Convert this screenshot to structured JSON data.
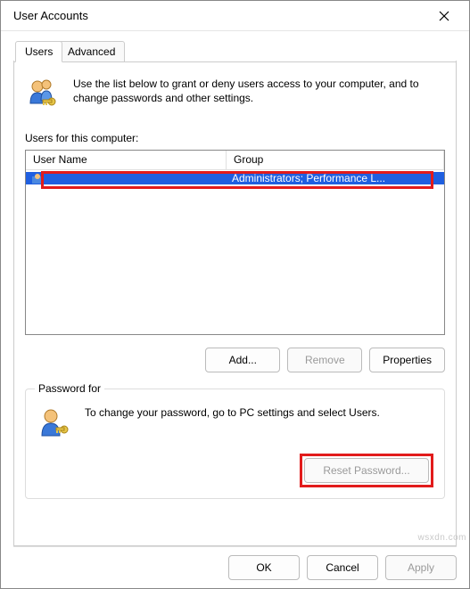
{
  "window": {
    "title": "User Accounts"
  },
  "tabs": {
    "users": "Users",
    "advanced": "Advanced"
  },
  "intro": {
    "text": "Use the list below to grant or deny users access to your computer, and to change passwords and other settings."
  },
  "list": {
    "label": "Users for this computer:",
    "columns": {
      "user": "User Name",
      "group": "Group"
    },
    "rows": [
      {
        "user": "",
        "group": "Administrators; Performance L..."
      }
    ]
  },
  "buttons": {
    "add": "Add...",
    "remove": "Remove",
    "properties": "Properties",
    "reset": "Reset Password...",
    "ok": "OK",
    "cancel": "Cancel",
    "apply": "Apply"
  },
  "password": {
    "group_title": "Password for",
    "text": "To change your password, go to PC settings and select Users."
  },
  "watermark": "wsxdn.com"
}
